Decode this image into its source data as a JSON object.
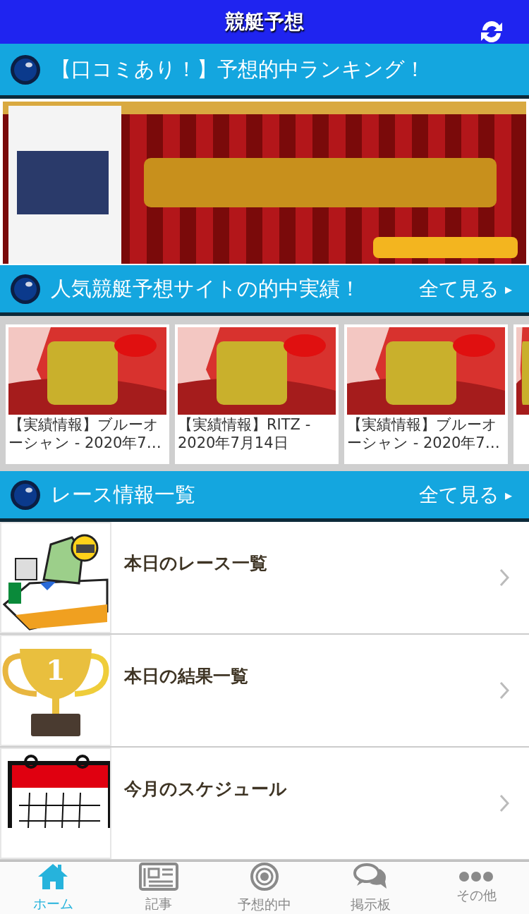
{
  "header": {
    "title": "競艇予想"
  },
  "ranking_section": {
    "title": "【口コミあり！】予想的中ランキング！"
  },
  "results_section": {
    "title": "人気競艇予想サイトの的中実績！",
    "more": "全て見る",
    "more_icon": "▸",
    "cards": [
      {
        "lines": [
          "【実績情報】ブルーオ",
          "ーシャン - 2020年7…"
        ],
        "partial": false
      },
      {
        "lines": [
          "【実績情報】RITZ -",
          "2020年7月14日"
        ],
        "partial": false
      },
      {
        "lines": [
          "【実績情報】ブルーオ",
          "ーシャン - 2020年7…"
        ],
        "partial": false
      },
      {
        "partial": true
      }
    ]
  },
  "race_section": {
    "title": "レース情報一覧",
    "more": "全て見る",
    "more_icon": "▸",
    "items": [
      {
        "kind": "boat",
        "label": "本日のレース一覧"
      },
      {
        "kind": "trophy",
        "label": "本日の結果一覧",
        "icon_text": "1"
      },
      {
        "kind": "calendar",
        "label": "今月のスケジュール"
      }
    ]
  },
  "tab_bar": [
    {
      "kind": "home",
      "label": "ホーム",
      "selected": true
    },
    {
      "kind": "news",
      "label": "記事",
      "selected": false
    },
    {
      "kind": "target",
      "label": "予想的中",
      "selected": false
    },
    {
      "kind": "chat",
      "label": "掲示板",
      "selected": false
    },
    {
      "kind": "more",
      "label": "その他",
      "selected": false
    }
  ]
}
